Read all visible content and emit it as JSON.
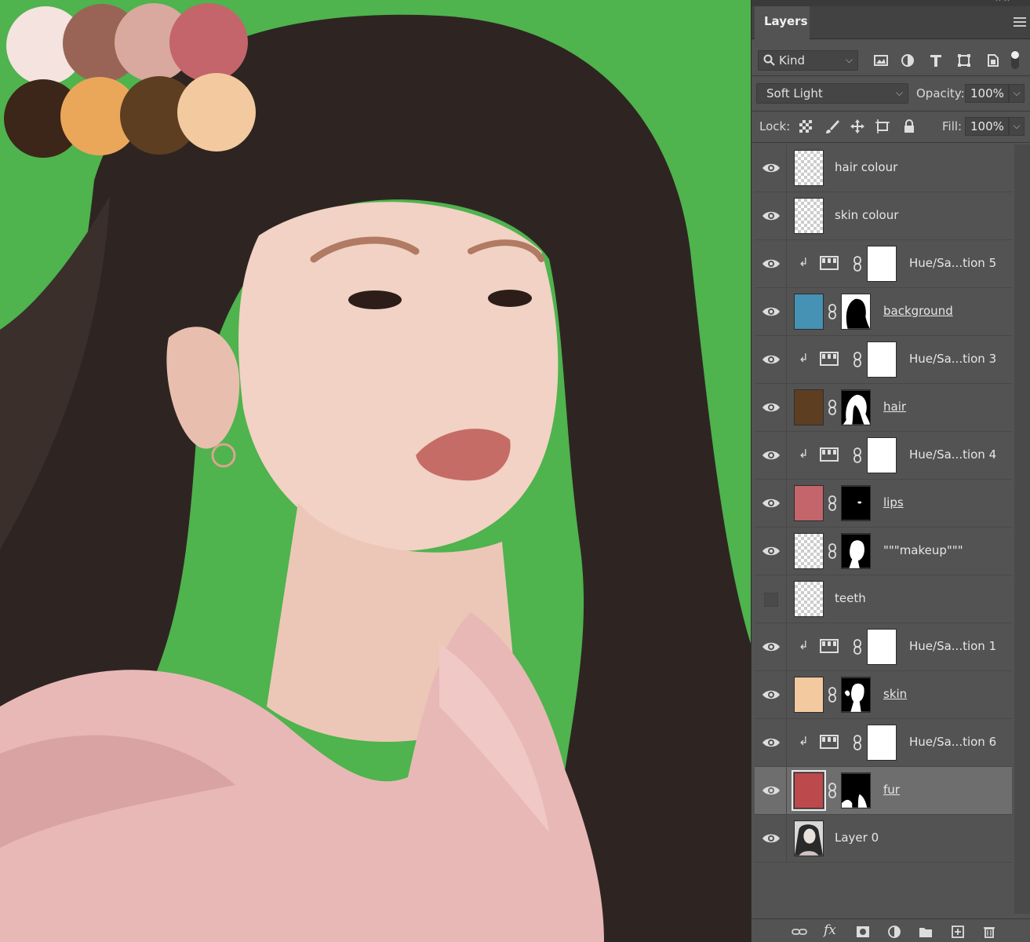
{
  "canvas": {
    "swatches": [
      {
        "color": "#f4e3df"
      },
      {
        "color": "#996455"
      },
      {
        "color": "#d9a89e"
      },
      {
        "color": "#c4646b"
      },
      {
        "color": "#3c2519"
      },
      {
        "color": "#eaa75a"
      },
      {
        "color": "#5e3e21"
      },
      {
        "color": "#f3c99f"
      }
    ],
    "background_color": "#4fb34e"
  },
  "panel": {
    "tab_label": "Layers",
    "filter": {
      "label": "Kind",
      "icon": "search-icon"
    },
    "filter_icons": [
      "image-filter-icon",
      "adjustment-filter-icon",
      "type-filter-icon",
      "shape-filter-icon",
      "smart-object-filter-icon",
      "filter-toggle-icon"
    ],
    "blend_mode": "Soft Light",
    "opacity_label": "Opacity:",
    "opacity_value": "100%",
    "lock_label": "Lock:",
    "lock_icons": [
      "lock-transparent-icon",
      "lock-image-icon",
      "lock-position-icon",
      "lock-artboard-icon",
      "lock-all-icon"
    ],
    "fill_label": "Fill:",
    "fill_value": "100%",
    "layers": [
      {
        "name": "hair colour",
        "visible": true,
        "type": "pixel",
        "thumb": "checker"
      },
      {
        "name": "skin colour",
        "visible": true,
        "type": "pixel",
        "thumb": "checker"
      },
      {
        "name": "Hue/Sa...tion 5",
        "visible": true,
        "type": "adjustment",
        "clipped": true
      },
      {
        "name": "background",
        "visible": true,
        "type": "fill",
        "color": "#4592b4",
        "mask": "bg"
      },
      {
        "name": "Hue/Sa...tion 3",
        "visible": true,
        "type": "adjustment",
        "clipped": true
      },
      {
        "name": "hair",
        "visible": true,
        "type": "fill",
        "color": "#5e3e21",
        "mask": "hair"
      },
      {
        "name": "Hue/Sa...tion 4",
        "visible": true,
        "type": "adjustment",
        "clipped": true
      },
      {
        "name": "lips",
        "visible": true,
        "type": "fill",
        "color": "#c4646b",
        "mask": "lips"
      },
      {
        "name": "\"\"\"makeup\"\"\"",
        "visible": true,
        "type": "pixelmask",
        "thumb": "checker",
        "mask": "face"
      },
      {
        "name": "teeth",
        "visible": false,
        "type": "pixel",
        "thumb": "checker"
      },
      {
        "name": "Hue/Sa...tion 1",
        "visible": true,
        "type": "adjustment",
        "clipped": true
      },
      {
        "name": "skin",
        "visible": true,
        "type": "fill",
        "color": "#f3c99f",
        "mask": "skin"
      },
      {
        "name": "Hue/Sa...tion 6",
        "visible": true,
        "type": "adjustment",
        "clipped": true
      },
      {
        "name": "fur",
        "visible": true,
        "type": "fill",
        "color": "#bc4a4c",
        "mask": "fur",
        "selected": true
      },
      {
        "name": "Layer 0",
        "visible": true,
        "type": "photo"
      }
    ],
    "bottom_icons": [
      "link-layers-icon",
      "fx-icon",
      "add-mask-icon",
      "new-adjustment-icon",
      "new-group-icon",
      "new-layer-icon",
      "delete-layer-icon"
    ]
  }
}
